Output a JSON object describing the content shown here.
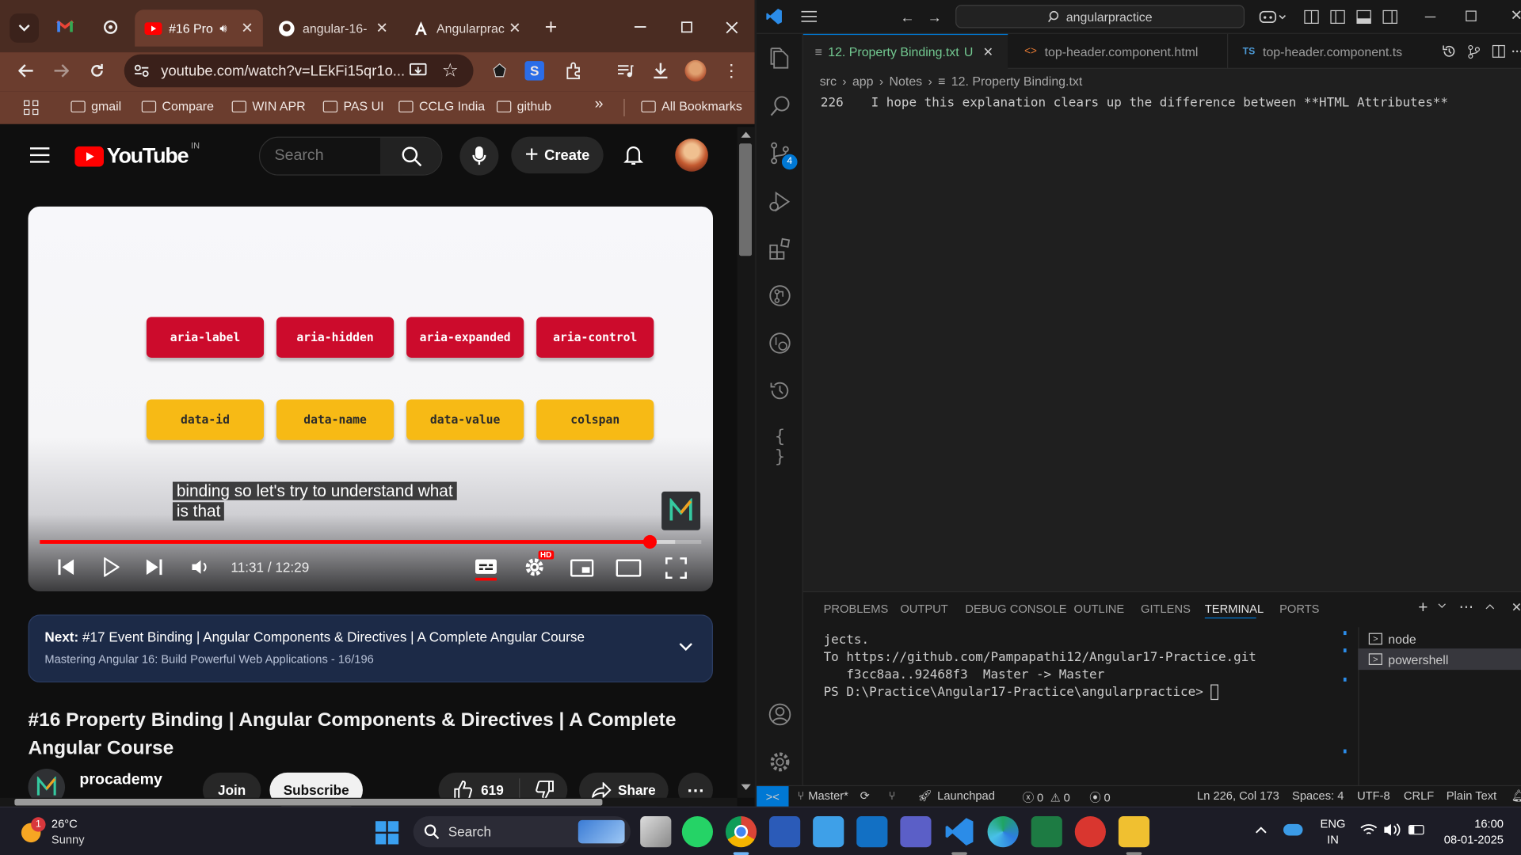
{
  "chrome": {
    "tabs": [
      {
        "title": "#16 Pro",
        "close": "✕"
      },
      {
        "title": "angular-16-",
        "close": "✕"
      },
      {
        "title": "Angularprac",
        "close": "✕"
      }
    ],
    "url": "youtube.com/watch?v=LEkFi15qr1o...",
    "bookmarks": [
      "gmail",
      "Compare",
      "WIN APR",
      "PAS UI",
      "CCLG India",
      "github"
    ],
    "more_bookmarks": "»",
    "all_bookmarks": "All Bookmarks",
    "accent": "#6b3d2e"
  },
  "youtube": {
    "logo": "YouTube",
    "country": "IN",
    "search_placeholder": "Search",
    "create_label": "Create",
    "player": {
      "red_pills": [
        "aria-label",
        "aria-hidden",
        "aria-expanded",
        "aria-control"
      ],
      "yellow_pills": [
        "data-id",
        "data-name",
        "data-value",
        "colspan"
      ],
      "caption_line1": "binding so let's try to understand what",
      "caption_line2": "is that",
      "time": "11:31 / 12:29",
      "progress": 0.923,
      "hd_badge": "HD"
    },
    "next": {
      "prefix": "Next:",
      "title": "#17 Event Binding | Angular Components & Directives | A Complete Angular Course",
      "playlist": "Mastering Angular 16: Build Powerful Web Applications - 16/196"
    },
    "video_title": "#16 Property Binding | Angular Components & Directives | A Complete Angular Course",
    "channel": "procademy",
    "join": "Join",
    "subscribe": "Subscribe",
    "likes": "619",
    "share": "Share"
  },
  "vscode": {
    "search": "angularpractice",
    "tabs": [
      {
        "name": "12. Property Binding.txt",
        "flag": "U"
      },
      {
        "name": "top-header.component.html"
      },
      {
        "name": "top-header.component.ts",
        "badge": "TS"
      }
    ],
    "breadcrumb": [
      "src",
      "app",
      "Notes",
      "12. Property Binding.txt"
    ],
    "line_number": "226",
    "line_text": "I hope this explanation clears up the difference between **HTML Attributes**",
    "source_control_badge": "4",
    "panel_tabs": [
      "PROBLEMS",
      "OUTPUT",
      "DEBUG CONSOLE",
      "OUTLINE",
      "GITLENS",
      "TERMINAL",
      "PORTS"
    ],
    "terminal": [
      "jects.",
      "To https://github.com/Pampapathi12/Angular17-Practice.git",
      "   f3cc8aa..92468f3  Master -> Master",
      "PS D:\\Practice\\Angular17-Practice\\angularpractice> "
    ],
    "terminals": [
      "node",
      "powershell"
    ],
    "status": {
      "branch": "Master*",
      "launchpad": "Launchpad",
      "errors": "0",
      "warnings": "0",
      "ports": "0",
      "position": "Ln 226, Col 173",
      "spaces": "Spaces: 4",
      "encoding": "UTF-8",
      "eol": "CRLF",
      "language": "Plain Text"
    }
  },
  "taskbar": {
    "weather_temp": "26°C",
    "weather_desc": "Sunny",
    "weather_badge": "1",
    "search": "Search",
    "lang1": "ENG",
    "lang2": "IN",
    "time": "16:00",
    "date": "08-01-2025"
  }
}
